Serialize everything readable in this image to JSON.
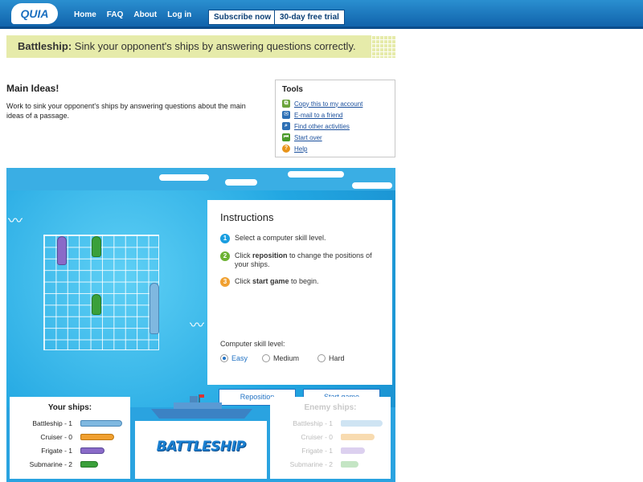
{
  "header": {
    "logo": "QUIA",
    "nav": [
      "Home",
      "FAQ",
      "About",
      "Log in"
    ],
    "subscribe": "Subscribe now",
    "trial": "30-day free trial"
  },
  "banner": {
    "bold": "Battleship:",
    "text": " Sink your opponent's ships by answering questions correctly."
  },
  "activity": {
    "title": "Main Ideas!",
    "description": "Work to sink your opponent's ships by answering questions about the main ideas of a passage."
  },
  "tools": {
    "title": "Tools",
    "items": [
      {
        "label": "Copy this to my account",
        "icon": "copy-icon",
        "color": "#6aa33a"
      },
      {
        "label": "E-mail to a friend",
        "icon": "email-icon",
        "color": "#2c6fb5"
      },
      {
        "label": "Find other activities",
        "icon": "search-icon",
        "color": "#2c6fb5"
      },
      {
        "label": "Start over",
        "icon": "rewind-icon",
        "color": "#4a9a2a"
      },
      {
        "label": "Help",
        "icon": "help-icon",
        "color": "#e8941a"
      }
    ]
  },
  "instructions": {
    "title": "Instructions",
    "step1": "Select a computer skill level.",
    "step2_pre": "Click ",
    "step2_bold": "reposition",
    "step2_post": " to change the positions of your ships.",
    "step3_pre": "Click ",
    "step3_bold": "start game",
    "step3_post": " to begin.",
    "skill_label": "Computer skill level:",
    "levels": [
      "Easy",
      "Medium",
      "Hard"
    ],
    "selected_level": "Easy",
    "reposition": "Reposition",
    "start": "Start game"
  },
  "your_ships": {
    "title": "Your ships:",
    "rows": [
      "Battleship - 1",
      "Cruiser - 0",
      "Frigate - 1",
      "Submarine - 2"
    ]
  },
  "enemy_ships": {
    "title": "Enemy ships:",
    "rows": [
      "Battleship - 1",
      "Cruiser - 0",
      "Frigate - 1",
      "Submarine - 2"
    ]
  },
  "game_logo": "BATTLESHIP",
  "colors": {
    "battleship": "#7fb8e0",
    "cruiser": "#f0a030",
    "frigate": "#8a6ac8",
    "submarine": "#3aa03a",
    "accent": "#2273c4"
  }
}
